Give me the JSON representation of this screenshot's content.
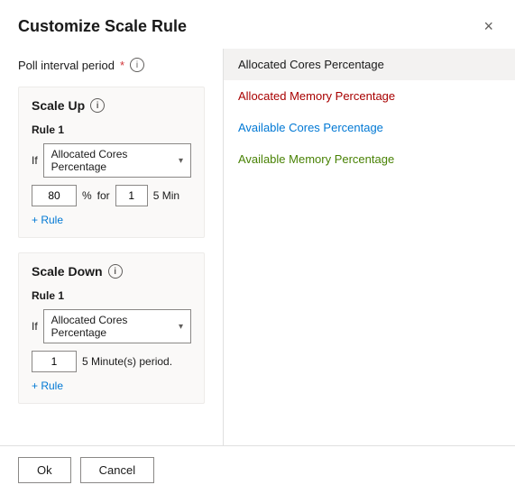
{
  "dialog": {
    "title": "Customize Scale Rule",
    "close_label": "×"
  },
  "left": {
    "poll_interval_label": "Poll interval period",
    "required_star": "*",
    "info_icon": "i",
    "scale_up": {
      "title": "Scale Up",
      "info_icon": "i",
      "rule1_label": "Rule 1",
      "if_label": "If",
      "dropdown_value": "Allocated Cores Percentage",
      "dropdown_arrow": "▾",
      "input_value": "80",
      "percent_label": "%",
      "for_label": "for",
      "duration_value": "1",
      "duration_unit": "5 Min",
      "add_rule_label": "+ Rule"
    },
    "scale_down": {
      "title": "Scale Down",
      "info_icon": "i",
      "rule1_label": "Rule 1",
      "if_label": "If",
      "dropdown_value": "Allocated Cores Percentage",
      "dropdown_arrow": "▾",
      "input_value": "1",
      "period_text": "5 Minute(s) period.",
      "add_rule_label": "+ Rule"
    }
  },
  "right": {
    "items": [
      {
        "label": "Allocated Cores Percentage",
        "color": "#1a1a1a",
        "active": true
      },
      {
        "label": "Allocated Memory Percentage",
        "color": "#a80000",
        "active": false
      },
      {
        "label": "Available Cores Percentage",
        "color": "#0078d4",
        "active": false
      },
      {
        "label": "Available Memory Percentage",
        "color": "#498205",
        "active": false
      }
    ]
  },
  "footer": {
    "ok_label": "Ok",
    "cancel_label": "Cancel"
  }
}
